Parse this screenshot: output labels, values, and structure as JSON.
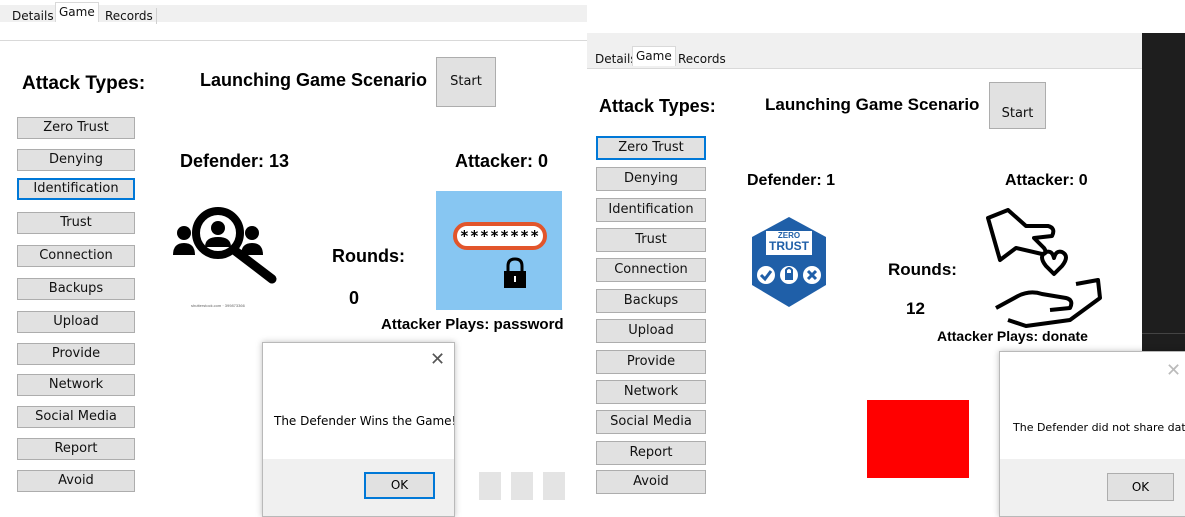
{
  "left_window": {
    "tabs": [
      "Details",
      "Game",
      "Records"
    ],
    "active_tab": "Game",
    "attack_types_heading": "Attack Types:",
    "scenario_heading": "Launching Game Scenario",
    "start_label": "Start",
    "defender_label": "Defender: 13",
    "attacker_label": "Attacker: 0",
    "rounds_label": "Rounds:",
    "rounds_value": "0",
    "attacker_plays": "Attacker Plays: password",
    "password_field_text": "********",
    "image_credit": "shutterstock.com · 399873366",
    "attack_buttons": [
      "Zero Trust",
      "Denying",
      "Identification",
      "Trust",
      "Connection",
      "Backups",
      "Upload",
      "Provide",
      "Network",
      "Social Media",
      "Report",
      "Avoid"
    ],
    "focused_button": "Identification",
    "dialog": {
      "message": "The Defender Wins the Game!",
      "ok_label": "OK",
      "close_glyph": "✕"
    },
    "colors": {
      "card_background": "#87c6f2",
      "password_border": "#e2552b"
    }
  },
  "right_window": {
    "tabs": [
      "Details",
      "Game",
      "Records"
    ],
    "active_tab": "Game",
    "attack_types_heading": "Attack Types:",
    "scenario_heading": "Launching Game Scenario",
    "start_label": "Start",
    "defender_label": "Defender: 1",
    "attacker_label": "Attacker: 0",
    "rounds_label": "Rounds:",
    "rounds_value": "12",
    "attacker_plays": "Attacker Plays: donate",
    "zero_trust_badge": {
      "line1": "ZERO",
      "line2": "TRUST"
    },
    "attack_buttons": [
      "Zero Trust",
      "Denying",
      "Identification",
      "Trust",
      "Connection",
      "Backups",
      "Upload",
      "Provide",
      "Network",
      "Social Media",
      "Report",
      "Avoid"
    ],
    "focused_button": "Zero Trust",
    "dialog": {
      "message": "The Defender did not share data",
      "ok_label": "OK",
      "close_glyph": "✕"
    },
    "colors": {
      "badge": "#1f5fa8",
      "status_square": "#ff0000"
    }
  }
}
